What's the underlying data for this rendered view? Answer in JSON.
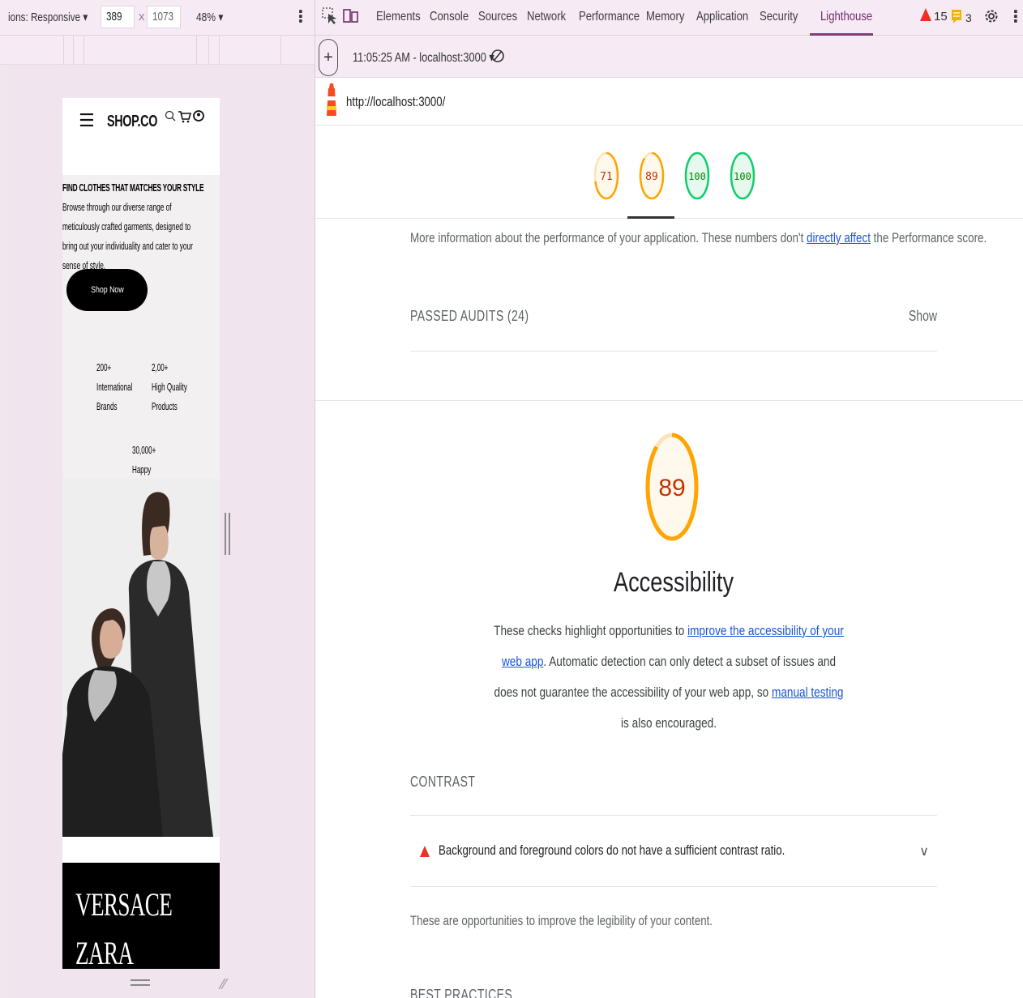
{
  "emulation": {
    "dimensions_label": "ions: Responsive ▾",
    "width": "389",
    "times": "x",
    "height": "1073",
    "zoom": "48% ▾",
    "menu": "⋮"
  },
  "site": {
    "logo": "SHOP.CO",
    "hero_title": "FIND CLOTHES THAT MATCHES YOUR STYLE",
    "hero_desc": "Browse through our diverse range of meticulously crafted garments, designed to bring out your individuality and cater to your sense of style.",
    "shop_now": "Shop Now",
    "stats": [
      {
        "value": "200+",
        "label1": "International",
        "label2": "Brands"
      },
      {
        "value": "2,00+",
        "label1": "High Quality",
        "label2": "Products"
      },
      {
        "value": "30,000+",
        "label1": "Happy",
        "label2": ""
      }
    ],
    "brands": [
      "VERSACE",
      "ZARA"
    ]
  },
  "devtools": {
    "tabs": [
      "Elements",
      "Console",
      "Sources",
      "Network",
      "Performance",
      "Memory",
      "Application",
      "Security",
      "Lighthouse"
    ],
    "active_tab": "Lighthouse",
    "warnings_count": "15",
    "issues_count": "3",
    "report_select": "11:05:25 AM - localhost:3000 ▾",
    "url": "http://localhost:3000/"
  },
  "report": {
    "scores": [
      {
        "value": "71",
        "color": "#ffa400"
      },
      {
        "value": "89",
        "color": "#ffa400"
      },
      {
        "value": "100",
        "color": "#0cce6b"
      },
      {
        "value": "100",
        "color": "#0cce6b"
      }
    ],
    "perf_info_pre": "More information about the performance of your application. These numbers don't ",
    "perf_info_link": "directly affect",
    "perf_info_post": " the Performance score.",
    "passed_label": "PASSED AUDITS (24)",
    "show": "Show",
    "category_score": "89",
    "category_score_fraction": 0.89,
    "category_title": "Accessibility",
    "desc_pre": "These checks highlight opportunities to ",
    "desc_link1": "improve the accessibility of your web app",
    "desc_mid": ". Automatic detection can only detect a subset of issues and does not guarantee the accessibility of your web app, so ",
    "desc_link2": "manual testing",
    "desc_post": " is also encouraged.",
    "contrast_label": "CONTRAST",
    "audit_title": "Background and foreground colors do not have a sufficient contrast ratio.",
    "legibility": "These are opportunities to improve the legibility of your content.",
    "best_practices_label": "BEST PRACTICES",
    "colors": {
      "orange": "#ffa400",
      "orange_text": "#c33300",
      "green": "#0cce6b",
      "green_text": "#008800",
      "fail": "#eb3223",
      "link": "#1a55d6"
    }
  }
}
